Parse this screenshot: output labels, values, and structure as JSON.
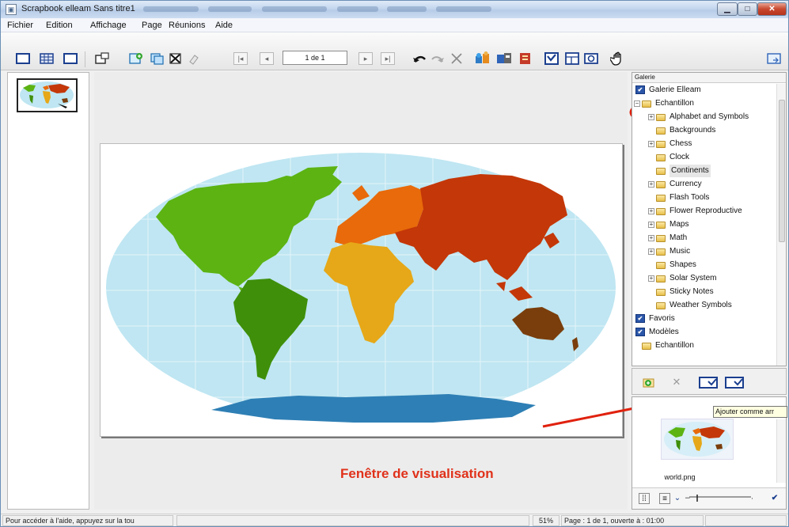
{
  "window": {
    "title": "Scrapbook elleam Sans titre1"
  },
  "menu": [
    {
      "label": "Fichier",
      "name": "menu-fichier"
    },
    {
      "label": "Edition",
      "name": "menu-edition"
    },
    {
      "label": "Affichage",
      "name": "menu-affichage"
    },
    {
      "label": "Page",
      "name": "menu-page"
    },
    {
      "label": "Réunions",
      "name": "menu-reunions"
    },
    {
      "label": "Aide",
      "name": "menu-aide"
    }
  ],
  "toolbar": {
    "page_indicator": "1 de 1"
  },
  "gallery": {
    "header": "Galerie",
    "items": [
      {
        "label": "Galerie Elleam",
        "kind": "check",
        "level": 0,
        "expander": ""
      },
      {
        "label": "Echantillon",
        "kind": "folder",
        "level": 1,
        "expander": "−"
      },
      {
        "label": "Alphabet and Symbols",
        "kind": "folder",
        "level": 2,
        "expander": "+"
      },
      {
        "label": "Backgrounds",
        "kind": "folder",
        "level": 2,
        "expander": ""
      },
      {
        "label": "Chess",
        "kind": "folder",
        "level": 2,
        "expander": "+"
      },
      {
        "label": "Clock",
        "kind": "folder",
        "level": 2,
        "expander": ""
      },
      {
        "label": "Continents",
        "kind": "folder",
        "level": 2,
        "expander": "",
        "selected": true
      },
      {
        "label": "Currency",
        "kind": "folder",
        "level": 2,
        "expander": "+"
      },
      {
        "label": "Flash Tools",
        "kind": "folder",
        "level": 2,
        "expander": ""
      },
      {
        "label": "Flower Reproductive",
        "kind": "folder",
        "level": 2,
        "expander": "+"
      },
      {
        "label": "Maps",
        "kind": "folder",
        "level": 2,
        "expander": "+"
      },
      {
        "label": "Math",
        "kind": "folder",
        "level": 2,
        "expander": "+"
      },
      {
        "label": "Music",
        "kind": "folder",
        "level": 2,
        "expander": "+"
      },
      {
        "label": "Shapes",
        "kind": "folder",
        "level": 2,
        "expander": ""
      },
      {
        "label": "Solar System",
        "kind": "folder",
        "level": 2,
        "expander": "+"
      },
      {
        "label": "Sticky Notes",
        "kind": "folder",
        "level": 2,
        "expander": ""
      },
      {
        "label": "Weather Symbols",
        "kind": "folder",
        "level": 2,
        "expander": ""
      },
      {
        "label": "Favoris",
        "kind": "check",
        "level": 0,
        "expander": ""
      },
      {
        "label": "Modèles",
        "kind": "check",
        "level": 0,
        "expander": ""
      },
      {
        "label": "Echantillon",
        "kind": "folder",
        "level": 1,
        "expander": ""
      }
    ]
  },
  "preview": {
    "tooltip": "Ajouter comme arr",
    "filename": "world.png"
  },
  "annotation": "Fenêtre de visualisation",
  "status": {
    "help": "Pour accéder à l'aide, appuyez sur la tou",
    "zoom": "51%",
    "page": "Page : 1 de 1, ouverte à : 01:00"
  },
  "colors": {
    "north_america": "#5cb312",
    "south_america": "#3f8f0a",
    "europe": "#e86a0a",
    "asia": "#c43708",
    "africa": "#e6a818",
    "oceania": "#7a3e0c",
    "antarctica": "#2e7fb5",
    "ocean": "#bfe6f2",
    "annotation": "#e0311a"
  }
}
